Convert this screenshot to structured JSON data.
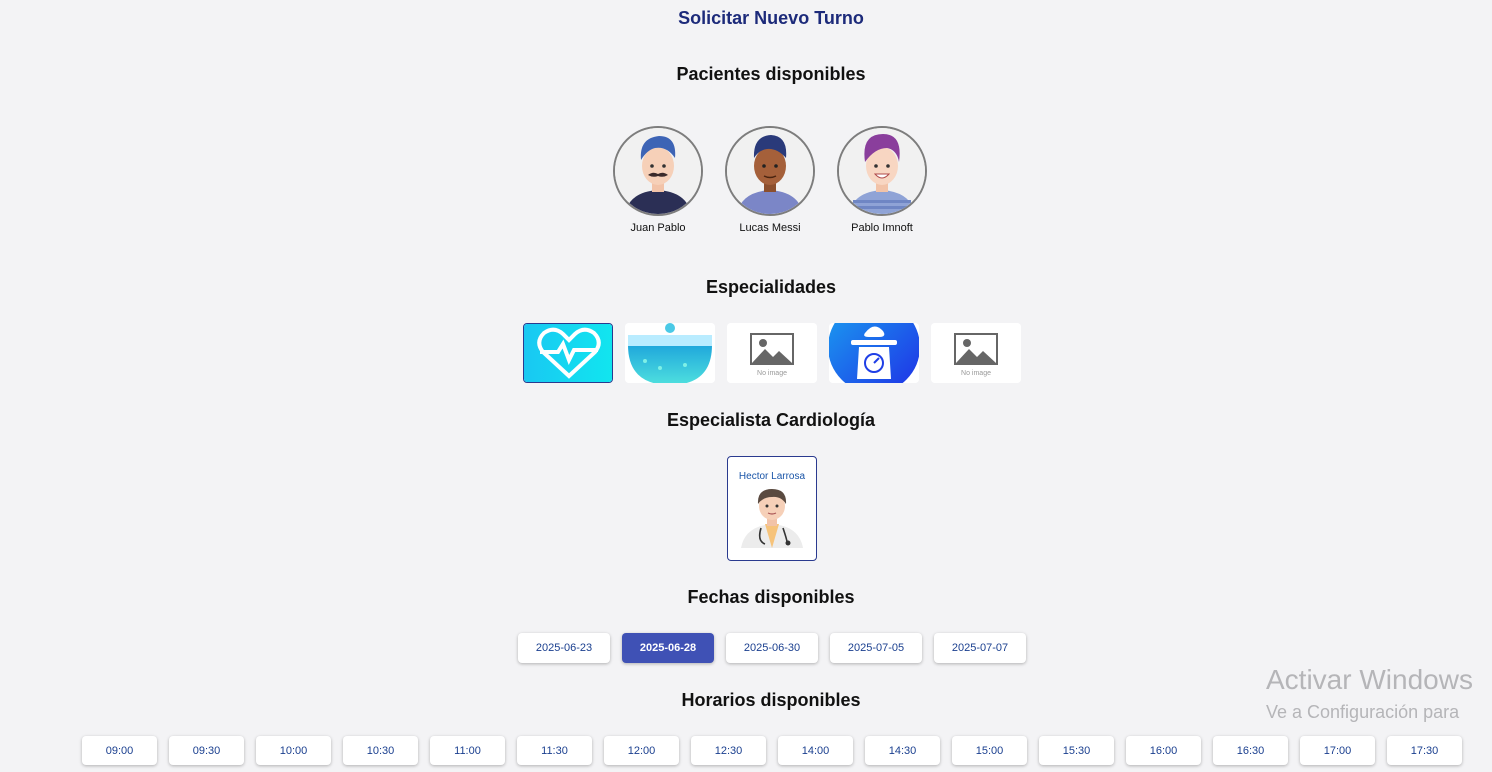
{
  "page": {
    "title": "Solicitar Nuevo Turno"
  },
  "patients": {
    "heading": "Pacientes disponibles",
    "items": [
      {
        "name": "Juan Pablo",
        "icon": "patient-avatar-mustache"
      },
      {
        "name": "Lucas Messi",
        "icon": "patient-avatar-dark-skin"
      },
      {
        "name": "Pablo Imnoft",
        "icon": "patient-avatar-purple-hair"
      }
    ]
  },
  "specialties": {
    "heading": "Especialidades",
    "items": [
      {
        "icon": "heart-pulse-icon",
        "selected": true
      },
      {
        "icon": "bowl-icon",
        "selected": false
      },
      {
        "icon": "no-image-placeholder",
        "caption": "No image",
        "selected": false
      },
      {
        "icon": "baby-scale-icon",
        "selected": false
      },
      {
        "icon": "no-image-placeholder",
        "caption": "No image",
        "selected": false
      }
    ]
  },
  "specialist": {
    "heading": "Especialista Cardiología",
    "doctor": {
      "name": "Hector Larrosa",
      "icon": "doctor-avatar"
    }
  },
  "dates": {
    "heading": "Fechas disponibles",
    "items": [
      "2025-06-23",
      "2025-06-28",
      "2025-06-30",
      "2025-07-05",
      "2025-07-07"
    ],
    "selected": "2025-06-28"
  },
  "times": {
    "heading": "Horarios disponibles",
    "items": [
      "09:00",
      "09:30",
      "10:00",
      "10:30",
      "11:00",
      "11:30",
      "12:00",
      "12:30",
      "14:00",
      "14:30",
      "15:00",
      "15:30",
      "16:00",
      "16:30",
      "17:00",
      "17:30"
    ]
  },
  "watermark": {
    "line1": "Activar Windows",
    "line2": "Ve a Configuración para"
  },
  "colors": {
    "title": "#1c2a7a",
    "accent": "#3f51b5",
    "button_text": "#1a3f8f",
    "background": "#f3f3f5"
  }
}
